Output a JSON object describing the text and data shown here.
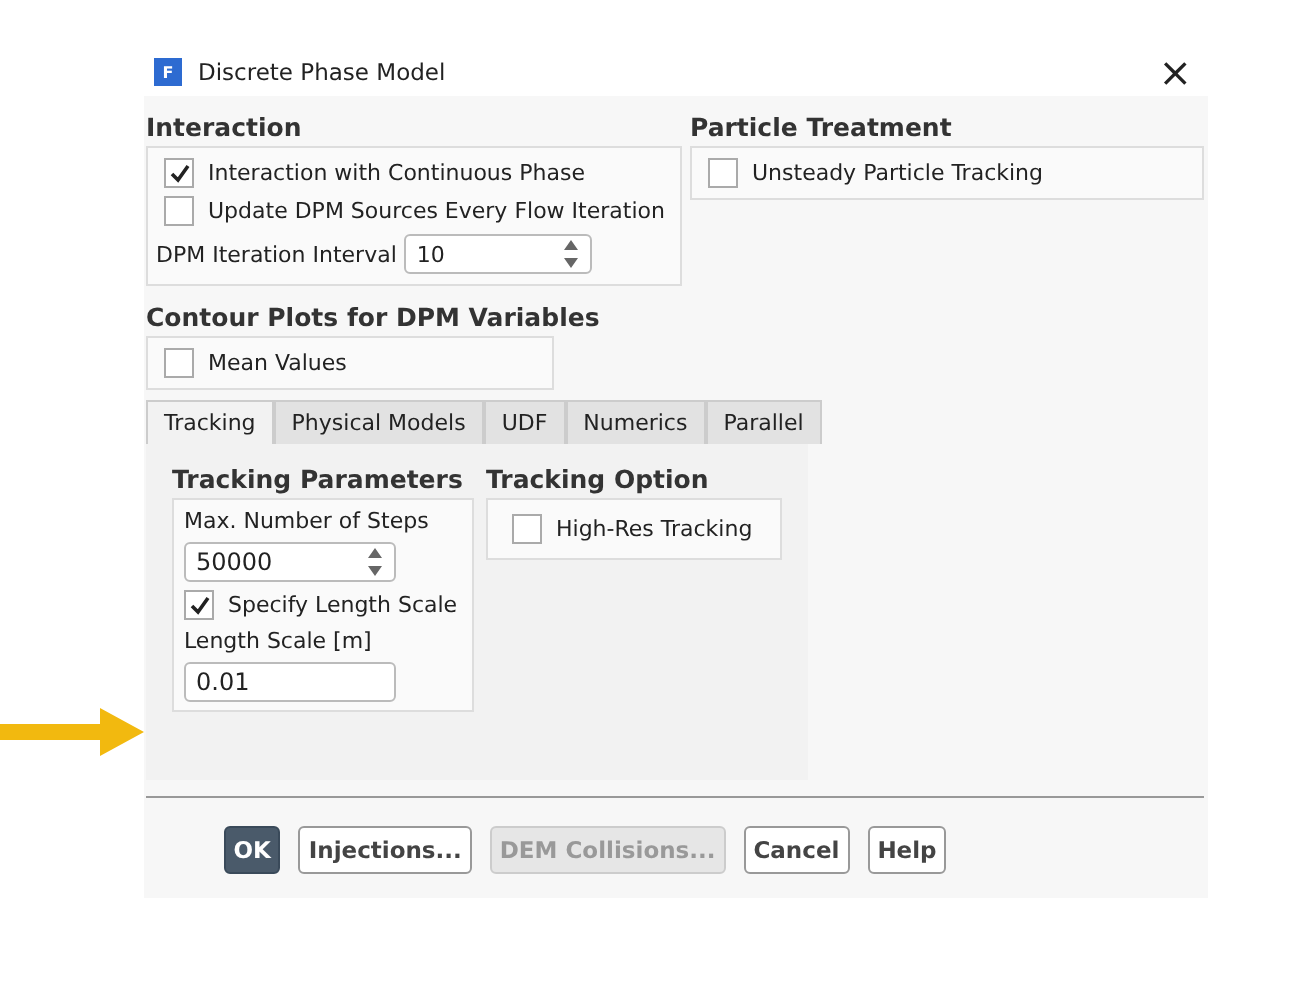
{
  "window": {
    "title": "Discrete Phase Model",
    "app_icon": "F",
    "close": "×"
  },
  "interaction": {
    "heading": "Interaction",
    "options": [
      {
        "label": "Interaction with Continuous Phase",
        "checked": true
      },
      {
        "label": "Update DPM Sources Every Flow Iteration",
        "checked": false
      }
    ],
    "interval": {
      "label": "DPM Iteration Interval",
      "value": "10"
    }
  },
  "particle_treatment": {
    "heading": "Particle Treatment",
    "options": [
      {
        "label": "Unsteady Particle Tracking",
        "checked": false
      }
    ]
  },
  "contour_plots": {
    "heading": "Contour Plots for DPM Variables",
    "options": [
      {
        "label": "Mean Values",
        "checked": false
      }
    ]
  },
  "tabs": [
    {
      "label": "Tracking",
      "selected": true
    },
    {
      "label": "Physical Models",
      "selected": false
    },
    {
      "label": "UDF",
      "selected": false
    },
    {
      "label": "Numerics",
      "selected": false
    },
    {
      "label": "Parallel",
      "selected": false
    }
  ],
  "tracking_parameters": {
    "heading": "Tracking Parameters",
    "max_steps": {
      "label": "Max. Number of Steps",
      "value": "50000"
    },
    "specify_length_scale": {
      "label": "Specify Length Scale",
      "checked": true
    },
    "length_scale": {
      "label": "Length Scale [m]",
      "value": "0.01"
    }
  },
  "tracking_option": {
    "heading": "Tracking Option",
    "options": [
      {
        "label": "High-Res Tracking",
        "checked": false
      }
    ]
  },
  "buttons": [
    {
      "label": "OK",
      "kind": "primary",
      "disabled": false
    },
    {
      "label": "Injections...",
      "kind": "normal",
      "disabled": false
    },
    {
      "label": "DEM Collisions...",
      "kind": "normal",
      "disabled": true
    },
    {
      "label": "Cancel",
      "kind": "normal",
      "disabled": false
    },
    {
      "label": "Help",
      "kind": "normal",
      "disabled": false
    }
  ]
}
